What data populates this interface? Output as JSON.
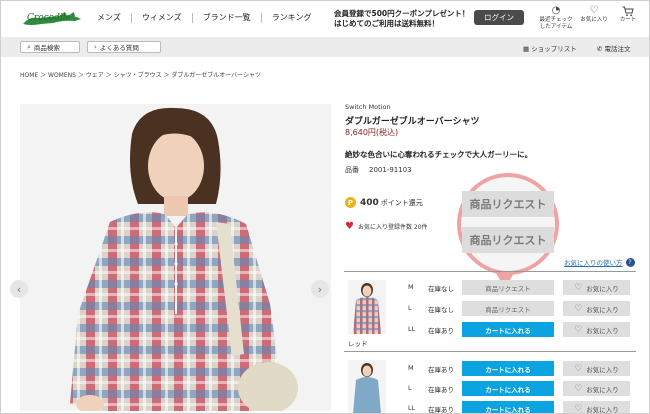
{
  "header": {
    "logo_text": "Crocodile",
    "nav": [
      "メンズ",
      "ウィメンズ",
      "ブランド一覧",
      "ランキング"
    ],
    "promo_line1": "会員登録で500円クーポンプレゼント！",
    "promo_line2": "はじめてのご利用は送料無料！",
    "login_label": "ログイン",
    "recent_label_1": "最近チェック",
    "recent_label_2": "したアイテム",
    "favorites_label": "お気に入り",
    "cart_label": "カート"
  },
  "subbar": {
    "search_label": "商品検索",
    "faq_label": "よくある質問",
    "shoplist_label": "ショップリスト",
    "phone_label": "電話注文"
  },
  "breadcrumb": "HOME ＞ WOMENS ＞ ウェア ＞ シャツ・ブラウス ＞ ダブルガーゼブルオーバーシャツ",
  "product": {
    "brand": "Switch Motion",
    "name": "ダブルガーゼブルオーバーシャツ",
    "price": "8,640円(税込)",
    "tagline": "絶妙な色合いに心奪われるチェックで大人ガーリーに。",
    "sku_label": "品番",
    "sku": "2001-91103",
    "points_value": "400",
    "points_suffix": "ポイント還元",
    "coin_symbol": "P",
    "fav_count_text": "お気に入り登録件数 20件",
    "howto_label": "お気に入りの使い方"
  },
  "callout": {
    "button1": "商品リクエスト",
    "button2": "商品リクエスト"
  },
  "colors": [
    {
      "name": "レッド",
      "rows": [
        {
          "size": "M",
          "stock": "在庫なし",
          "action": "商品リクエスト",
          "type": "request",
          "fav": "お気に入り"
        },
        {
          "size": "L",
          "stock": "在庫なし",
          "action": "商品リクエスト",
          "type": "request",
          "fav": "お気に入り"
        },
        {
          "size": "LL",
          "stock": "在庫あり",
          "action": "カートに入れる",
          "type": "cart",
          "fav": "お気に入り"
        }
      ]
    },
    {
      "name": "",
      "rows": [
        {
          "size": "M",
          "stock": "在庫あり",
          "action": "カートに入れる",
          "type": "cart",
          "fav": "お気に入り"
        },
        {
          "size": "L",
          "stock": "在庫あり",
          "action": "カートに入れる",
          "type": "cart",
          "fav": "お気に入り"
        },
        {
          "size": "LL",
          "stock": "在庫あり",
          "action": "カートに入れる",
          "type": "cart",
          "fav": "お気に入り"
        }
      ]
    }
  ],
  "colors_theme": {
    "accent_cart": "#0ba4e0",
    "callout_ring": "#f0a3a3",
    "price_red": "#8b2222"
  }
}
